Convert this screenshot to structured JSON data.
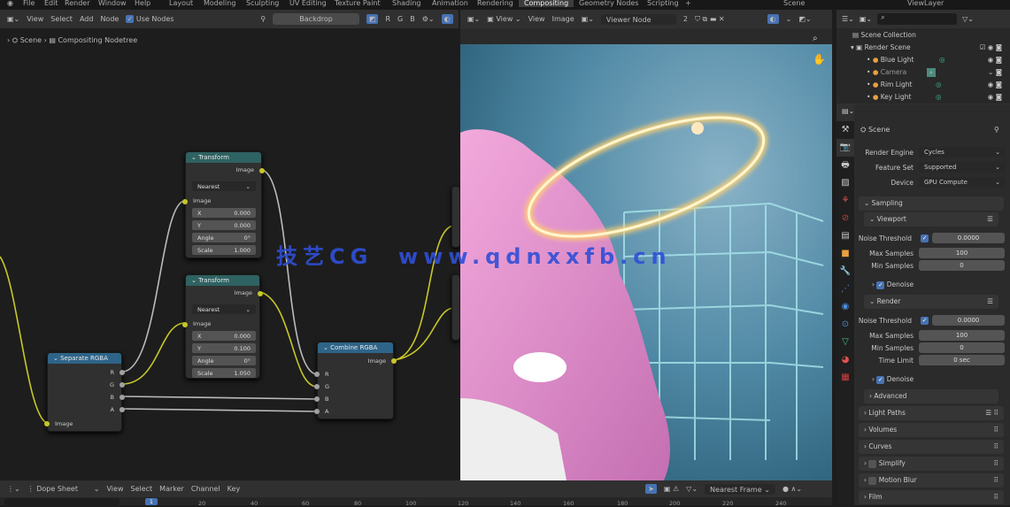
{
  "top_menu": {
    "items": [
      "File",
      "Edit",
      "Render",
      "Window",
      "Help"
    ],
    "workspaces": [
      "Layout",
      "Modeling",
      "Sculpting",
      "UV Editing",
      "Texture Paint",
      "Shading",
      "Animation",
      "Rendering",
      "Compositing",
      "Geometry Nodes",
      "Scripting"
    ],
    "active_workspace": "Compositing",
    "scene": "Scene",
    "view_layer": "ViewLayer"
  },
  "node_editor": {
    "menu": [
      "View",
      "Select",
      "Add",
      "Node"
    ],
    "use_nodes": "Use Nodes",
    "backdrop": "Backdrop",
    "channels": [
      "R",
      "G",
      "B"
    ],
    "breadcrumb": [
      "Scene",
      "Compositing Nodetree"
    ],
    "nodes": {
      "transform1": {
        "title": "Transform",
        "output": "Image",
        "filter": "Nearest",
        "input": "Image",
        "fields": [
          [
            "X",
            "0.000"
          ],
          [
            "Y",
            "0.000"
          ],
          [
            "Angle",
            "0°"
          ],
          [
            "Scale",
            "1.000"
          ]
        ]
      },
      "transform2": {
        "title": "Transform",
        "output": "Image",
        "filter": "Nearest",
        "input": "Image",
        "fields": [
          [
            "X",
            "0.000"
          ],
          [
            "Y",
            "0.100"
          ],
          [
            "Angle",
            "0°"
          ],
          [
            "Scale",
            "1.050"
          ]
        ]
      },
      "separate": {
        "title": "Separate RGBA",
        "outputs": [
          "R",
          "G",
          "B",
          "A"
        ],
        "input": "Image"
      },
      "combine": {
        "title": "Combine RGBA",
        "output": "Image",
        "inputs": [
          "R",
          "G",
          "B",
          "A"
        ]
      }
    }
  },
  "watermark": "技艺CG  www.qdnxxfb.cn",
  "image_editor": {
    "menu": [
      "View",
      "View",
      "Image"
    ],
    "image_name": "Viewer Node",
    "users": "2"
  },
  "outliner": {
    "root": "Scene Collection",
    "collection": "Render Scene",
    "items": [
      "Blue Light",
      "Camera",
      "Rim Light",
      "Key Light"
    ]
  },
  "properties": {
    "title": "Scene",
    "render_engine_label": "Render Engine",
    "render_engine": "Cycles",
    "feature_set_label": "Feature Set",
    "feature_set": "Supported",
    "device_label": "Device",
    "device": "GPU Compute",
    "sampling": "Sampling",
    "viewport": "Viewport",
    "render": "Render",
    "noise_threshold_label": "Noise Threshold",
    "viewport_noise": "0.0000",
    "max_samples_label": "Max Samples",
    "viewport_max": "100",
    "min_samples_label": "Min Samples",
    "viewport_min": "0",
    "denoise": "Denoise",
    "render_noise": "0.0000",
    "render_max": "100",
    "render_min": "0",
    "time_limit_label": "Time Limit",
    "time_limit": "0 sec",
    "advanced": "Advanced",
    "panels": [
      "Light Paths",
      "Volumes",
      "Curves",
      "Simplify",
      "Motion Blur",
      "Film"
    ]
  },
  "dope_sheet": {
    "mode": "Dope Sheet",
    "menu": [
      "View",
      "Select",
      "Marker",
      "Channel",
      "Key"
    ],
    "snap": "Nearest Frame",
    "current_frame": "1",
    "ticks": [
      "20",
      "40",
      "60",
      "80",
      "100",
      "120",
      "140",
      "160",
      "180",
      "200",
      "220",
      "240"
    ]
  }
}
